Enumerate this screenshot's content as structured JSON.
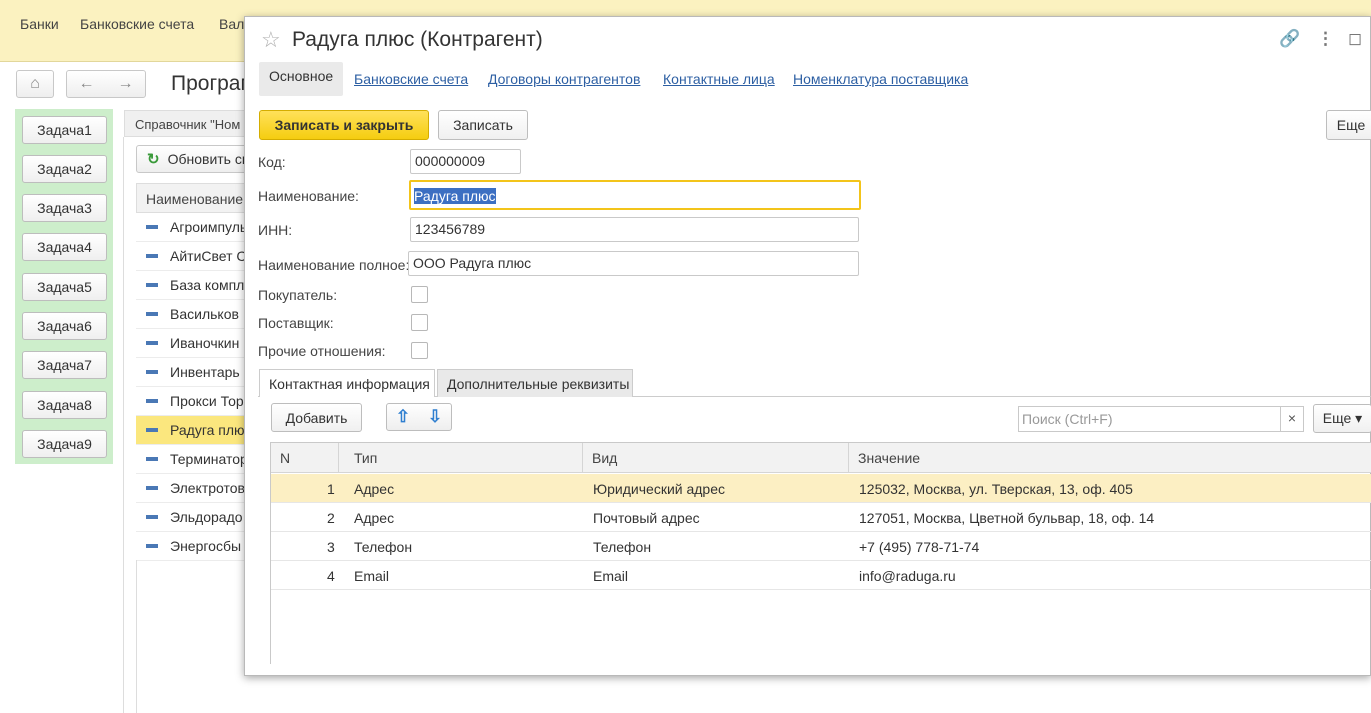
{
  "top_menu": [
    "Банки",
    "Банковские счета",
    "Вал"
  ],
  "background": {
    "title": "Програм",
    "list_header": "Справочник \"Ном",
    "refresh_label": "Обновить сп",
    "column_header": "Наименование",
    "rows": [
      "Агроимпуль",
      "АйтиСвет С",
      "База компл",
      "Васильков",
      "Иваночкин",
      "Инвентарь",
      "Прокси Тор",
      "Радуга плю",
      "Терминатор",
      "Электротов",
      "Эльдорадо",
      "Энергосбы"
    ],
    "selected_row": 7
  },
  "tasks": [
    "Задача1",
    "Задача2",
    "Задача3",
    "Задача4",
    "Задача5",
    "Задача6",
    "Задача7",
    "Задача8",
    "Задача9"
  ],
  "modal": {
    "title": "Радуга плюс (Контрагент)",
    "tabs": [
      "Основное",
      "Банковские счета",
      "Договоры контрагентов",
      "Контактные лица",
      "Номенклатура поставщика"
    ],
    "save_close_label": "Записать и закрыть",
    "save_label": "Записать",
    "more_label": "Еще",
    "fields": {
      "code_label": "Код:",
      "code_value": "000000009",
      "name_label": "Наименование:",
      "name_value": "Радуга плюс",
      "inn_label": "ИНН:",
      "inn_value": "123456789",
      "full_name_label": "Наименование полное:",
      "full_name_value": "ООО Радуга плюс",
      "buyer_label": "Покупатель:",
      "supplier_label": "Поставщик:",
      "other_label": "Прочие отношения:"
    },
    "subtabs": [
      "Контактная информация",
      "Дополнительные реквизиты"
    ],
    "add_label": "Добавить",
    "search_placeholder": "Поиск (Ctrl+F)",
    "search_clear": "×",
    "more2_label": "Еще ▾",
    "table": {
      "columns": [
        "N",
        "Тип",
        "Вид",
        "Значение"
      ],
      "rows": [
        {
          "n": "1",
          "type": "Адрес",
          "kind": "Юридический адрес",
          "value": "125032, Москва, ул. Тверская, 13, оф. 405"
        },
        {
          "n": "2",
          "type": "Адрес",
          "kind": "Почтовый адрес",
          "value": "127051, Москва, Цветной бульвар, 18, оф. 14"
        },
        {
          "n": "3",
          "type": "Телефон",
          "kind": "Телефон",
          "value": "+7 (495) 778-71-74"
        },
        {
          "n": "4",
          "type": "Email",
          "kind": "Email",
          "value": "info@raduga.ru"
        }
      ],
      "selected_row": 0
    }
  }
}
